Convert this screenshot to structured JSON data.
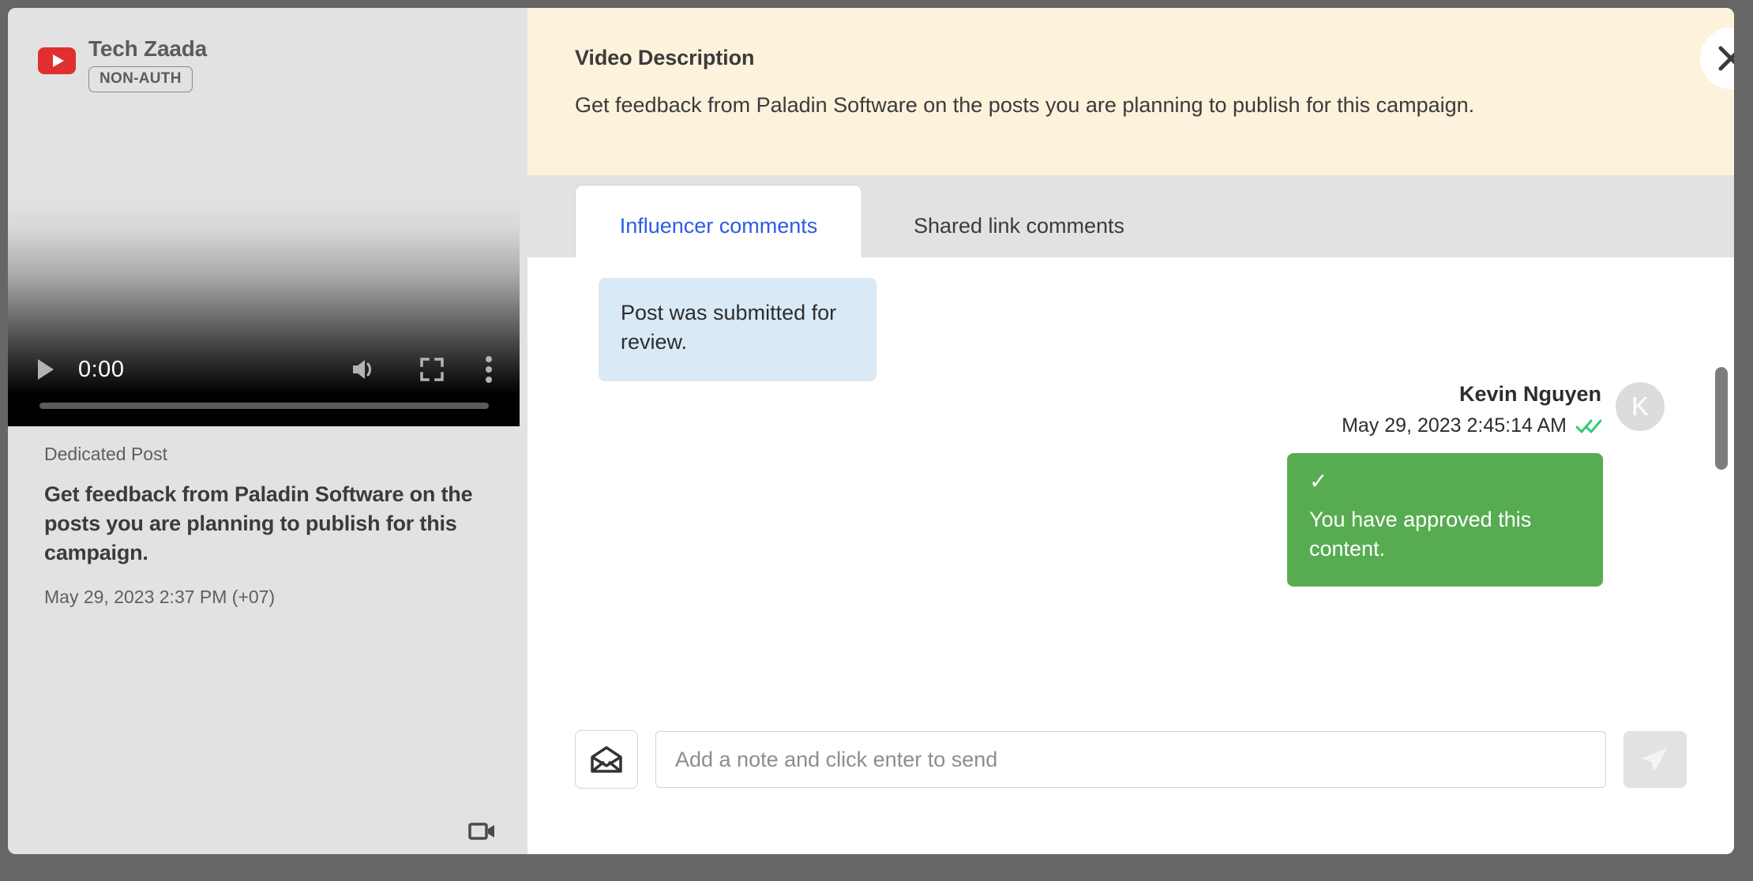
{
  "modal": {
    "close_label": "✕"
  },
  "left": {
    "channel_name": "Tech Zaada",
    "auth_badge": "NON-AUTH",
    "platform_icon": "youtube-icon",
    "video": {
      "current_time": "0:00",
      "play_icon": "play-icon",
      "volume_icon": "volume-icon",
      "fullscreen_icon": "fullscreen-icon",
      "more_icon": "more-vertical-icon"
    },
    "post": {
      "kind": "Dedicated Post",
      "title": "Get feedback from Paladin Software on the posts you are planning to publish for this campaign.",
      "date": "May 29, 2023 2:37 PM (+07)"
    },
    "media_type_icon": "video-camera-icon"
  },
  "right": {
    "description": {
      "title": "Video Description",
      "body": "Get feedback from Paladin Software on the posts you are planning to publish for this campaign."
    },
    "tabs": [
      {
        "label": "Influencer comments",
        "active": true
      },
      {
        "label": "Shared link comments",
        "active": false
      }
    ],
    "messages": [
      {
        "side": "left",
        "text": "Post was submitted for review."
      },
      {
        "side": "right",
        "author": "Kevin Nguyen",
        "timestamp": "May 29, 2023 2:45:14 AM",
        "read_icon": "double-check-icon",
        "avatar_initial": "K",
        "status_icon": "check-icon",
        "text": "You have approved this content."
      }
    ],
    "composer": {
      "attach_icon": "open-envelope-icon",
      "placeholder": "Add a note and click enter to send",
      "value": "",
      "send_icon": "send-plane-icon"
    }
  },
  "colors": {
    "accent_blue": "#2b5ce6",
    "approved_green": "#57ac52",
    "description_bg": "#fdf2dc",
    "bubble_blue": "#d9e9f5",
    "panel_grey": "#e2e2e2",
    "backdrop": "#666666"
  }
}
